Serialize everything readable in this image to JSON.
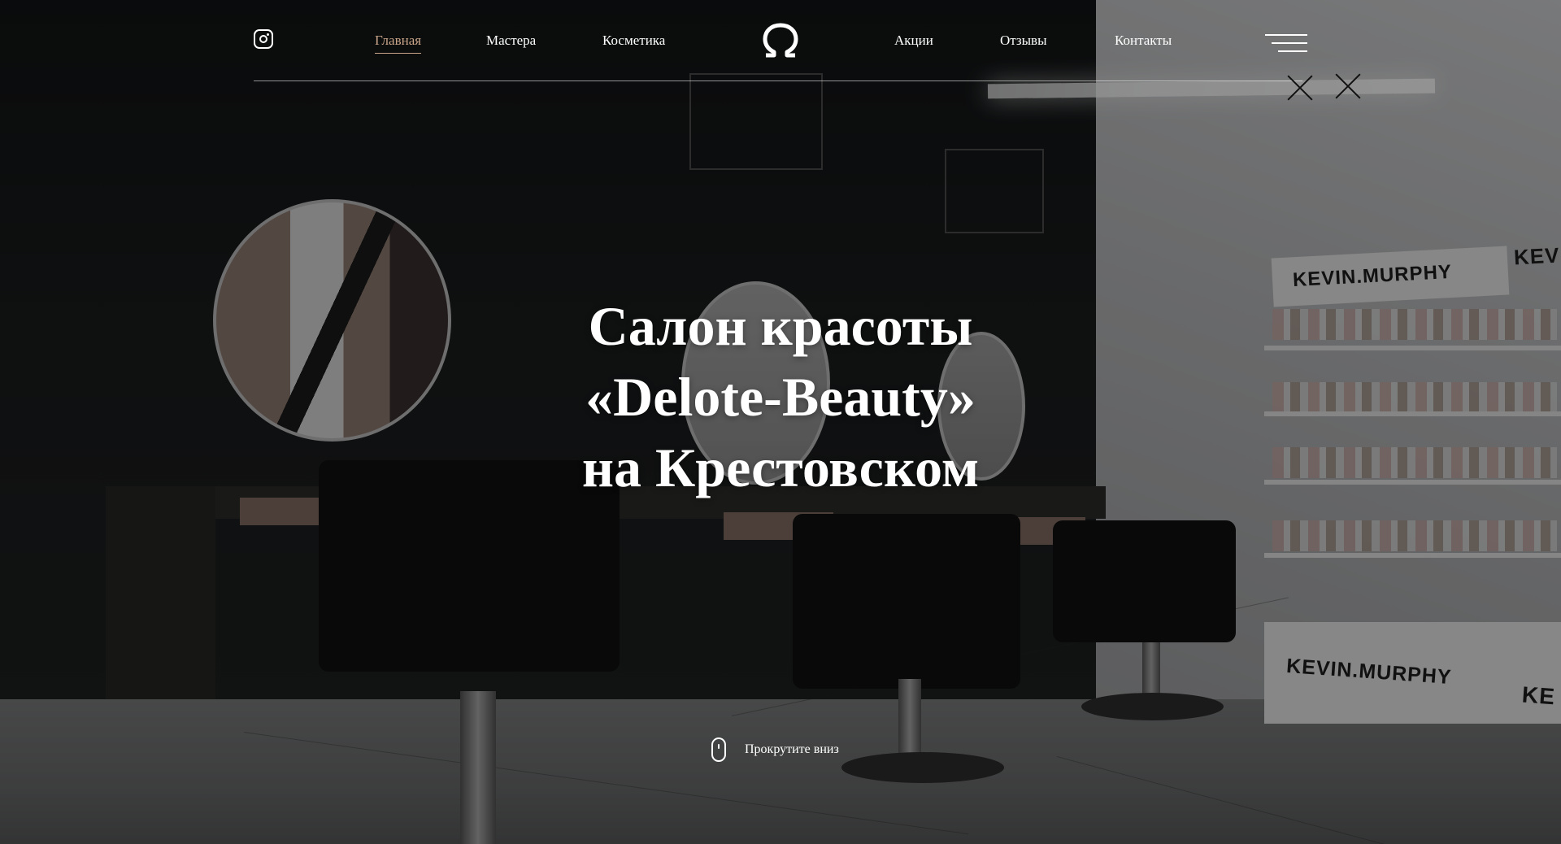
{
  "nav": {
    "left": [
      "Главная",
      "Мастера",
      "Косметика"
    ],
    "right": [
      "Акции",
      "Отзывы",
      "Контакты"
    ],
    "active_index": 0,
    "active_color": "#c9a58a"
  },
  "icons": {
    "social": "instagram-icon",
    "logo": "omega-logo",
    "menu": "hamburger-menu-icon",
    "close": "close-icon"
  },
  "hero": {
    "line1": "Салон красоты",
    "line2": "«Delote-Beauty»",
    "line3": "на Крестовском"
  },
  "scroll_hint": "Прокрутите вниз",
  "background": {
    "brand_labels": [
      "KEVIN.MURPHY",
      "KEV",
      "KEVIN.MURPHY",
      "KE"
    ]
  }
}
